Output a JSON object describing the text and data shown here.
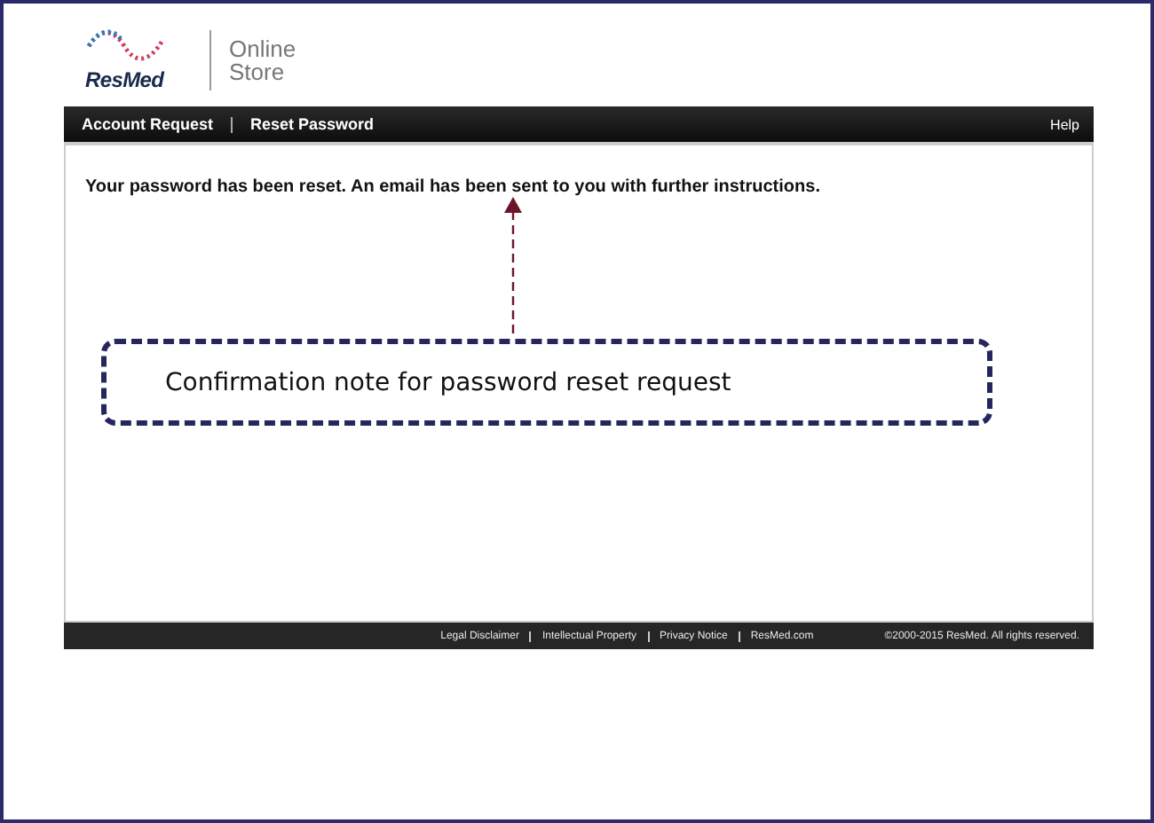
{
  "header": {
    "brand": "ResMed",
    "store_label": [
      "Online",
      "Store"
    ]
  },
  "nav": {
    "items": [
      "Account Request",
      "Reset Password"
    ],
    "help": "Help"
  },
  "message": "Your password has been reset. An email has been sent to you with further instructions.",
  "callout": {
    "text": "Confirmation note for password reset request"
  },
  "footer": {
    "links": [
      "Legal Disclaimer",
      "Intellectual Property",
      "Privacy Notice",
      "ResMed.com"
    ],
    "copyright": "©2000-2015 ResMed. All rights reserved."
  }
}
